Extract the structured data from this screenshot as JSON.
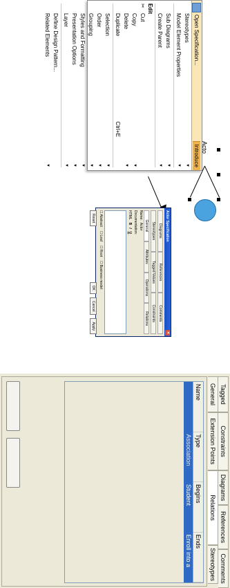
{
  "diagram": {
    "actor_label": "Acto"
  },
  "context_menu": {
    "header_title": "Open Specification...",
    "header_tab": "Introduce",
    "groups": [
      {
        "items": [
          {
            "label": "Stereotypes",
            "submenu": true
          },
          {
            "label": "Model Element Properties",
            "submenu": true
          }
        ]
      },
      {
        "items": [
          {
            "label": "Sub Diagrams",
            "submenu": true
          },
          {
            "label": "Create Parent",
            "submenu": true
          }
        ]
      }
    ],
    "edit_label": "Edit",
    "edit_items": [
      {
        "label": "Cut",
        "submenu": false
      },
      {
        "label": "Copy",
        "submenu": true
      },
      {
        "label": "Delete",
        "submenu": true
      },
      {
        "label": "Duplicate",
        "shortcut": "Ctrl+E",
        "submenu": false
      }
    ],
    "groups2": [
      {
        "items": [
          {
            "label": "Selection",
            "submenu": true
          },
          {
            "label": "Order",
            "submenu": true
          },
          {
            "label": "Grouping",
            "submenu": true
          },
          {
            "label": "Styles and Formatting",
            "submenu": true
          },
          {
            "label": "Presentation Options",
            "submenu": true
          },
          {
            "label": "Layer",
            "submenu": true
          }
        ]
      },
      {
        "items": [
          {
            "label": "Define Design Pattern...",
            "submenu": false
          },
          {
            "label": "Related Elements",
            "submenu": true
          }
        ]
      }
    ]
  },
  "spec_dialog": {
    "title": "Actor Specification",
    "tabs_row1": [
      "Diagrams",
      "References",
      "Comments"
    ],
    "tabs_row2": [
      "Stereotypes",
      "Tagged Values",
      "Constraints"
    ],
    "tabs_row3": [
      "General",
      "Attributes",
      "Operations",
      "Relations"
    ],
    "name_label": "Name:",
    "name_value": "Actor",
    "documentation_label": "Documentation:",
    "format_label": "HTML",
    "toolbar": [
      "B",
      "I",
      "U"
    ],
    "checks": [
      "Abstract",
      "Leaf",
      "Root",
      "Business model"
    ],
    "buttons": [
      "Reset",
      "OK",
      "Cancel",
      "Apply"
    ]
  },
  "relations_dialog": {
    "tabs_row1": [
      "Tagged Values",
      "Constraints",
      "Diagrams",
      "References",
      "Comments"
    ],
    "tabs_row2": [
      "General",
      "Extension Points",
      "Relations",
      "Stereotypes"
    ],
    "active_tab": "Relations",
    "columns": [
      "Name",
      "Type",
      "Begins",
      "Ends"
    ],
    "rows": [
      {
        "name": "",
        "type": "Association",
        "begins": "Student",
        "ends": "Enroll into a course"
      }
    ]
  },
  "colors": {
    "selection": "#316ac5",
    "menu_header": "#fbe7b6",
    "usecase_fill": "#4aa3df",
    "dialog_bg": "#ece9d8"
  }
}
